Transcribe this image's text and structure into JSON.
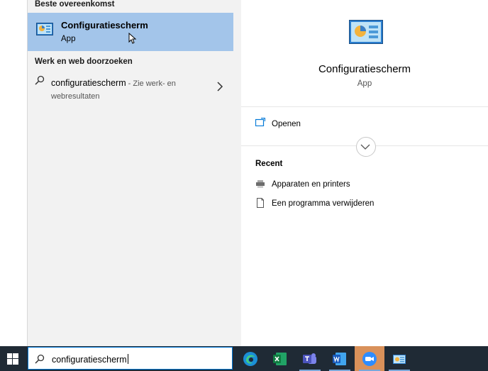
{
  "search_panel": {
    "best_match_heading": "Beste overeenkomst",
    "best_match": {
      "title": "Configuratiescherm",
      "subtitle": "App"
    },
    "web_heading": "Werk en web doorzoeken",
    "web_result": {
      "query": "configuratiescherm",
      "hint": "- Zie werk- en webresultaten"
    }
  },
  "detail_panel": {
    "title": "Configuratiescherm",
    "subtitle": "App",
    "open_label": "Openen",
    "recent_heading": "Recent",
    "recent_items": [
      {
        "label": "Apparaten en printers",
        "icon": "printer-icon"
      },
      {
        "label": "Een programma verwijderen",
        "icon": "document-icon"
      }
    ]
  },
  "taskbar": {
    "search_value": "configuratiescherm",
    "apps": [
      {
        "name": "Microsoft Edge",
        "icon": "edge-icon"
      },
      {
        "name": "Excel",
        "icon": "excel-icon"
      },
      {
        "name": "Teams",
        "icon": "teams-icon"
      },
      {
        "name": "Word",
        "icon": "word-icon"
      },
      {
        "name": "Zoom",
        "icon": "zoom-icon",
        "active": true
      },
      {
        "name": "Configuratiescherm",
        "icon": "control-panel-icon"
      }
    ]
  },
  "colors": {
    "selection": "#a3c5ea",
    "accent": "#0078d7",
    "taskbar": "#1f2a35"
  }
}
